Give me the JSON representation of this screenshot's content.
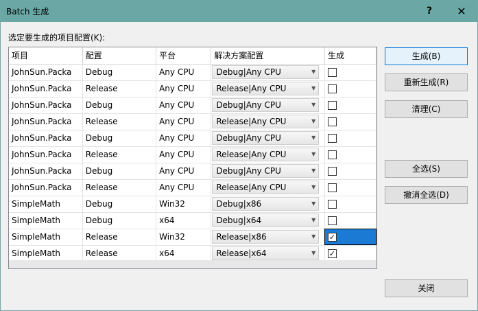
{
  "window": {
    "title": "Batch 生成",
    "help_glyph": "?",
    "close_glyph": "✕"
  },
  "prompt": "选定要生成的项目配置(K):",
  "columns": [
    "项目",
    "配置",
    "平台",
    "解决方案配置",
    "生成"
  ],
  "rows": [
    {
      "project": "JohnSun.Packa",
      "config": "Debug",
      "platform": "Any CPU",
      "solution": "Debug|Any CPU",
      "build": false
    },
    {
      "project": "JohnSun.Packa",
      "config": "Release",
      "platform": "Any CPU",
      "solution": "Release|Any CPU",
      "build": false
    },
    {
      "project": "JohnSun.Packa",
      "config": "Debug",
      "platform": "Any CPU",
      "solution": "Debug|Any CPU",
      "build": false
    },
    {
      "project": "JohnSun.Packa",
      "config": "Release",
      "platform": "Any CPU",
      "solution": "Release|Any CPU",
      "build": false
    },
    {
      "project": "JohnSun.Packa",
      "config": "Debug",
      "platform": "Any CPU",
      "solution": "Debug|Any CPU",
      "build": false
    },
    {
      "project": "JohnSun.Packa",
      "config": "Release",
      "platform": "Any CPU",
      "solution": "Release|Any CPU",
      "build": false
    },
    {
      "project": "JohnSun.Packa",
      "config": "Debug",
      "platform": "Any CPU",
      "solution": "Debug|Any CPU",
      "build": false
    },
    {
      "project": "JohnSun.Packa",
      "config": "Release",
      "platform": "Any CPU",
      "solution": "Release|Any CPU",
      "build": false
    },
    {
      "project": "SimpleMath",
      "config": "Debug",
      "platform": "Win32",
      "solution": "Debug|x86",
      "build": false
    },
    {
      "project": "SimpleMath",
      "config": "Debug",
      "platform": "x64",
      "solution": "Debug|x64",
      "build": false
    },
    {
      "project": "SimpleMath",
      "config": "Release",
      "platform": "Win32",
      "solution": "Release|x86",
      "build": true,
      "selected": true
    },
    {
      "project": "SimpleMath",
      "config": "Release",
      "platform": "x64",
      "solution": "Release|x64",
      "build": true
    }
  ],
  "buttons": {
    "build": "生成(B)",
    "rebuild": "重新生成(R)",
    "clean": "清理(C)",
    "select_all": "全选(S)",
    "deselect_all": "撤消全选(D)",
    "close": "关闭"
  },
  "colors": {
    "titlebar": "#6aa7a5",
    "selection": "#1a7ad4",
    "primary_border": "#0078d7"
  }
}
